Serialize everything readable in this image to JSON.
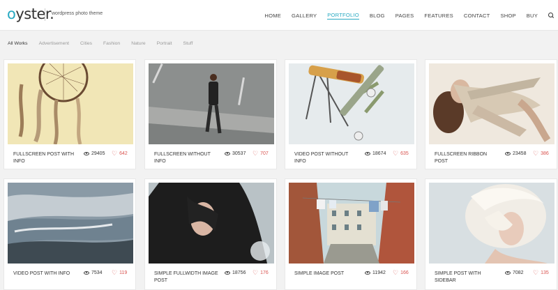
{
  "site": {
    "logo_first": "o",
    "logo_rest": "yster.",
    "tagline": "wordpress photo theme"
  },
  "nav": {
    "items": [
      "HOME",
      "GALLERY",
      "PORTFOLIO",
      "BLOG",
      "PAGES",
      "FEATURES",
      "CONTACT",
      "SHOP",
      "BUY"
    ],
    "active": "PORTFOLIO",
    "search_icon": "search-icon"
  },
  "filters": [
    "All Works",
    "Advertisement",
    "Cities",
    "Fashion",
    "Nature",
    "Portrait",
    "Stuff"
  ],
  "active_filter": "All Works",
  "colors": {
    "accent": "#27a9c2",
    "like": "#d9534f"
  },
  "cards": [
    {
      "title": "FULLSCREEN POST WITH INFO",
      "views": "29405",
      "likes": "642"
    },
    {
      "title": "FULLSCREEN WITHOUT INFO",
      "views": "30537",
      "likes": "707"
    },
    {
      "title": "VIDEO POST WITHOUT INFO",
      "views": "18674",
      "likes": "635"
    },
    {
      "title": "FULLSCREEN RIBBON POST",
      "views": "23458",
      "likes": "386"
    },
    {
      "title": "VIDEO POST WITH INFO",
      "views": "7534",
      "likes": "119"
    },
    {
      "title": "SIMPLE FULLWIDTH IMAGE POST",
      "views": "18756",
      "likes": "176"
    },
    {
      "title": "SIMPLE IMAGE POST",
      "views": "11942",
      "likes": "166"
    },
    {
      "title": "SIMPLE POST WITH SIDEBAR",
      "views": "7082",
      "likes": "135"
    }
  ]
}
